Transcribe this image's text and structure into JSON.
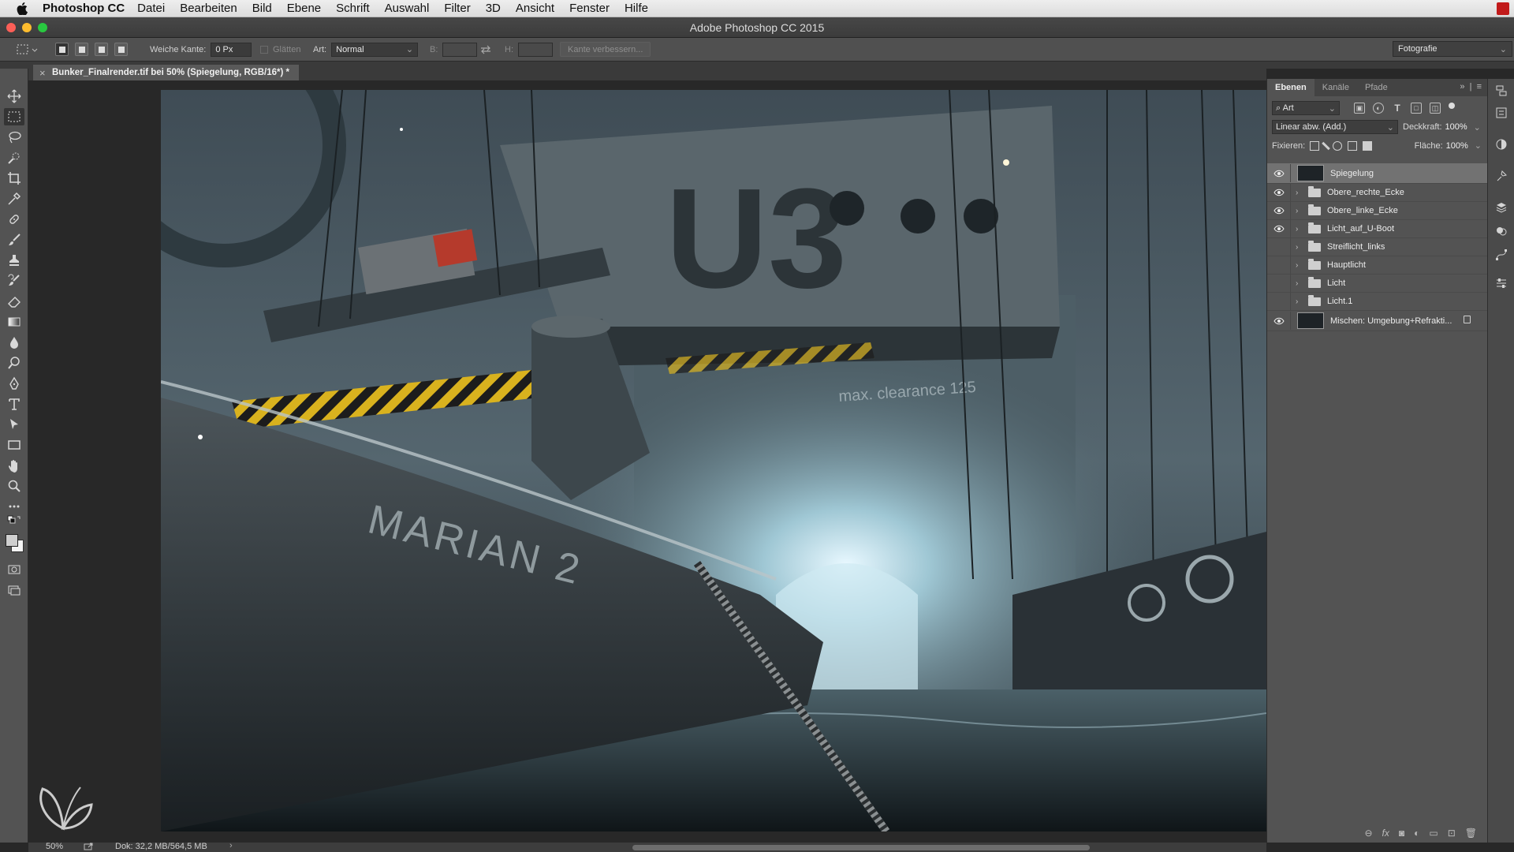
{
  "menubar": {
    "app_name": "Photoshop CC",
    "items": [
      "Datei",
      "Bearbeiten",
      "Bild",
      "Ebene",
      "Schrift",
      "Auswahl",
      "Filter",
      "3D",
      "Ansicht",
      "Fenster",
      "Hilfe"
    ]
  },
  "window": {
    "title": "Adobe Photoshop CC 2015"
  },
  "options": {
    "feather_label": "Weiche Kante:",
    "feather_value": "0 Px",
    "antialias_label": "Glätten",
    "style_label": "Art:",
    "style_value": "Normal",
    "width_label": "B:",
    "height_label": "H:",
    "refine_label": "Kante verbessern...",
    "workspace": "Fotografie"
  },
  "document": {
    "tab_title": "Bunker_Finalrender.tif bei 50% (Spiegelung, RGB/16*) *",
    "close_glyph": "×"
  },
  "artwork": {
    "sign_text": "U3",
    "hull_text": "MARIAN 2",
    "clearance_text": "max. clearance 125"
  },
  "status": {
    "zoom": "50%",
    "doc_size": "Dok: 32,2 MB/564,5 MB",
    "arrow": "›"
  },
  "layers_panel": {
    "tabs": [
      "Ebenen",
      "Kanäle",
      "Pfade"
    ],
    "filter": "Art",
    "blend_mode": "Linear abw. (Add.)",
    "opacity_label": "Deckkraft:",
    "opacity_value": "100%",
    "lock_label": "Fixieren:",
    "fill_label": "Fläche:",
    "fill_value": "100%",
    "layers": [
      {
        "name": "Spiegelung",
        "visible": true,
        "type": "pixel",
        "selected": true
      },
      {
        "name": "Obere_rechte_Ecke",
        "visible": true,
        "type": "group"
      },
      {
        "name": "Obere_linke_Ecke",
        "visible": true,
        "type": "group"
      },
      {
        "name": "Licht_auf_U-Boot",
        "visible": true,
        "type": "group"
      },
      {
        "name": "Streiflicht_links",
        "visible": false,
        "type": "group"
      },
      {
        "name": "Hauptlicht",
        "visible": false,
        "type": "group"
      },
      {
        "name": "Licht",
        "visible": false,
        "type": "group"
      },
      {
        "name": "Licht.1",
        "visible": false,
        "type": "group"
      },
      {
        "name": "Mischen: Umgebung+Refrakti...",
        "visible": true,
        "type": "pixel",
        "locked": true
      }
    ]
  },
  "colors": {
    "accent_red": "#c11a1a",
    "panel_bg": "#535353",
    "selected_layer": "#727272"
  }
}
